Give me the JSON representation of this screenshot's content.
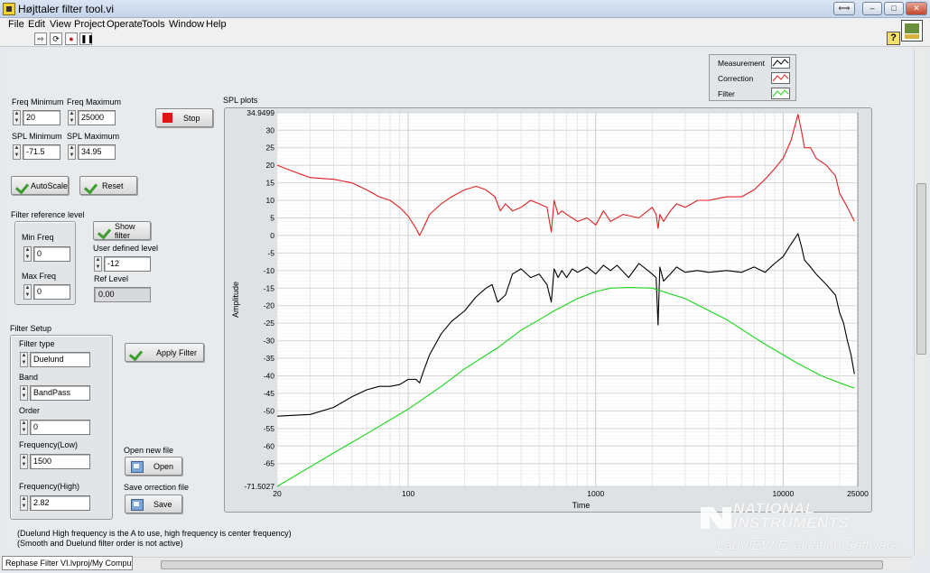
{
  "window": {
    "title": "Højttaler filter tool.vi",
    "controls": {
      "restore_alt": "⟺",
      "minimize": "–",
      "maximize": "□",
      "close": "✕"
    }
  },
  "menu": [
    "File",
    "Edit",
    "View",
    "Project",
    "Operate",
    "Tools",
    "Window",
    "Help"
  ],
  "toolbar": {
    "run": "⇨",
    "run_continuous": "⟳",
    "abort": "●",
    "pause": "❚❚",
    "help": "?"
  },
  "controls": {
    "freq_min": {
      "label": "Freq Minimum",
      "value": "20"
    },
    "freq_max": {
      "label": "Freq Maximum",
      "value": "25000"
    },
    "spl_min": {
      "label": "SPL Minimum",
      "value": "-71.5"
    },
    "spl_max": {
      "label": "SPL Maximum",
      "value": "34.95"
    },
    "stop_label": "Stop",
    "autoscale_label": "AutoScale",
    "reset_label": "Reset",
    "filter_ref_level": {
      "title": "Filter reference level",
      "min_freq_label": "Min Freq",
      "min_freq_value": "0",
      "max_freq_label": "Max Freq",
      "max_freq_value": "0"
    },
    "show_filter_label": "Show filter",
    "user_defined_level": {
      "label": "User defined level",
      "value": "-12"
    },
    "ref_level": {
      "label": "Ref Level",
      "value": "0.00"
    },
    "filter_setup": {
      "title": "Filter Setup",
      "filter_type_label": "Filter type",
      "filter_type_value": "Duelund",
      "band_label": "Band",
      "band_value": "BandPass",
      "order_label": "Order",
      "order_value": "0",
      "freq_low_label": "Frequency(Low)",
      "freq_low_value": "1500",
      "freq_high_label": "Frequency(High)",
      "freq_high_value": "2.82"
    },
    "apply_filter_label": "Apply Filter",
    "open_new_file": {
      "label": "Open new file",
      "button": "Open"
    },
    "save_correction": {
      "label": "Save orrection file",
      "button": "Save"
    }
  },
  "notes": [
    "(Duelund High frequency is the A to use, high frequency is center frequency)",
    "(Smooth and Duelund filter order is not active)"
  ],
  "graph_title": "SPL plots",
  "legend": [
    {
      "name": "Measurement",
      "color": "#000000"
    },
    {
      "name": "Correction",
      "color": "#e02020"
    },
    {
      "name": "Filter",
      "color": "#19d619"
    }
  ],
  "watermark": {
    "brand_line1": "NATIONAL",
    "brand_line2": "INSTRUMENTS",
    "sub": "LabVIEW Evaluation Software"
  },
  "status_path": "Rephase Filter VI.lvproj/My Computer",
  "chart_data": {
    "type": "line",
    "title": "SPL plots",
    "xlabel": "Time",
    "ylabel": "Amplitude",
    "xscale": "log",
    "xlim": [
      20,
      25000
    ],
    "ylim": [
      -71.5027,
      34.9499
    ],
    "x_ticks": [
      "20",
      "100",
      "1000",
      "10000",
      "25000"
    ],
    "y_ticks": [
      "34.9499",
      "30",
      "25",
      "20",
      "15",
      "10",
      "5",
      "0",
      "-5",
      "-10",
      "-15",
      "-20",
      "-25",
      "-30",
      "-35",
      "-40",
      "-45",
      "-50",
      "-55",
      "-60",
      "-65",
      "-71.5027"
    ],
    "grid": true,
    "legend_position": "top-right",
    "series": [
      {
        "name": "Measurement",
        "color": "#000000",
        "x": [
          20,
          30,
          40,
          50,
          60,
          70,
          80,
          90,
          100,
          110,
          115,
          120,
          130,
          150,
          170,
          200,
          230,
          260,
          280,
          300,
          330,
          360,
          400,
          450,
          500,
          550,
          580,
          600,
          630,
          660,
          700,
          750,
          800,
          900,
          1000,
          1100,
          1200,
          1300,
          1500,
          1700,
          1900,
          2000,
          2100,
          2150,
          2200,
          2300,
          2500,
          2700,
          3000,
          3500,
          4000,
          5000,
          6000,
          7000,
          8000,
          9000,
          10000,
          11000,
          12000,
          12500,
          13000,
          14000,
          15000,
          17000,
          19000,
          20000,
          21000,
          22000,
          23000,
          24000
        ],
        "y": [
          -51.5,
          -51,
          -49,
          -46,
          -44,
          -43,
          -43,
          -42.5,
          -41,
          -41,
          -42,
          -39,
          -34,
          -28,
          -24.5,
          -21.5,
          -17.5,
          -15,
          -14,
          -19,
          -17,
          -11,
          -9.5,
          -12,
          -11,
          -14,
          -19,
          -9.5,
          -12,
          -10,
          -12,
          -9.5,
          -10.5,
          -9,
          -11,
          -8.5,
          -10,
          -8.5,
          -12,
          -8,
          -10,
          -11,
          -12,
          -25.5,
          -9,
          -13,
          -11,
          -9,
          -10.5,
          -10,
          -10.5,
          -10,
          -10.5,
          -9,
          -10.5,
          -8,
          -6,
          -2.5,
          0.5,
          -3,
          -7,
          -9,
          -11,
          -14,
          -17,
          -22,
          -25,
          -30,
          -34,
          -39.5
        ]
      },
      {
        "name": "Correction",
        "color": "#e02020",
        "x": [
          20,
          25,
          30,
          40,
          50,
          60,
          70,
          80,
          90,
          100,
          110,
          115,
          120,
          130,
          150,
          170,
          200,
          230,
          260,
          290,
          310,
          330,
          360,
          400,
          450,
          500,
          550,
          580,
          600,
          630,
          660,
          700,
          800,
          900,
          1000,
          1100,
          1200,
          1400,
          1700,
          2000,
          2100,
          2150,
          2200,
          2300,
          2500,
          2700,
          3000,
          3500,
          4000,
          5000,
          6000,
          7000,
          8000,
          9000,
          10000,
          11000,
          12000,
          12500,
          13000,
          14000,
          15000,
          17000,
          19000,
          20000,
          21000,
          22000,
          23000,
          24000
        ],
        "y": [
          20,
          18,
          16.5,
          16,
          15,
          13,
          11,
          10,
          8,
          5.5,
          2,
          0,
          2,
          6,
          9,
          11,
          13,
          14,
          13,
          11,
          7,
          9,
          7,
          8,
          10,
          9,
          8,
          1,
          10,
          6,
          7,
          6,
          4,
          5,
          3,
          7,
          4,
          6,
          5,
          8,
          6,
          2,
          6,
          4,
          7,
          9,
          8,
          10,
          10,
          11,
          11,
          13,
          16,
          19,
          22,
          27,
          34.5,
          30,
          25,
          25,
          22,
          20,
          17,
          12,
          10,
          8,
          6,
          4
        ]
      },
      {
        "name": "Filter",
        "color": "#19d619",
        "x": [
          20,
          40,
          60,
          100,
          150,
          200,
          300,
          400,
          500,
          600,
          800,
          1000,
          1200,
          1500,
          2000,
          3000,
          5000,
          8000,
          12000,
          16000,
          20000,
          24000
        ],
        "y": [
          -71.5,
          -62,
          -56.5,
          -49.5,
          -43,
          -38,
          -32,
          -27,
          -24,
          -21.5,
          -18,
          -16,
          -15,
          -14.8,
          -15,
          -18,
          -24,
          -31,
          -36.5,
          -40,
          -42,
          -43.5
        ]
      }
    ]
  }
}
